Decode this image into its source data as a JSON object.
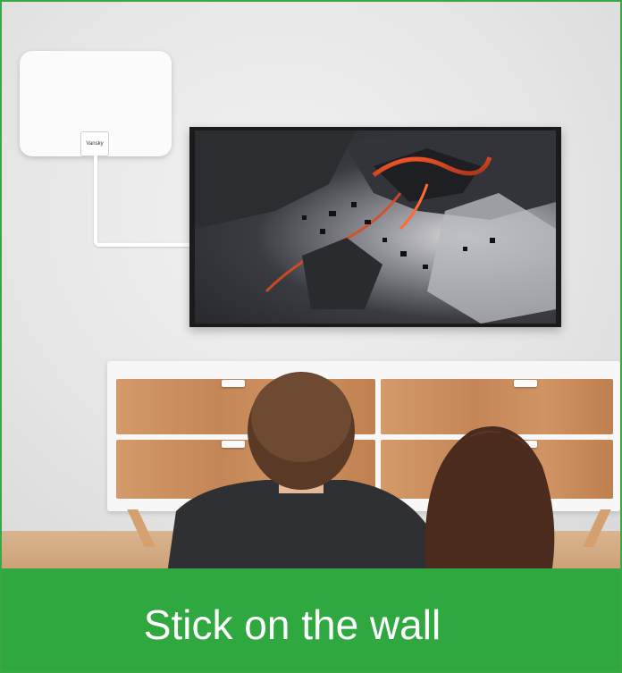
{
  "antenna": {
    "brand": "Vansky"
  },
  "caption": {
    "text": "Stick on the wall"
  },
  "colors": {
    "banner": "#2fa83f",
    "border": "#3aa844"
  }
}
